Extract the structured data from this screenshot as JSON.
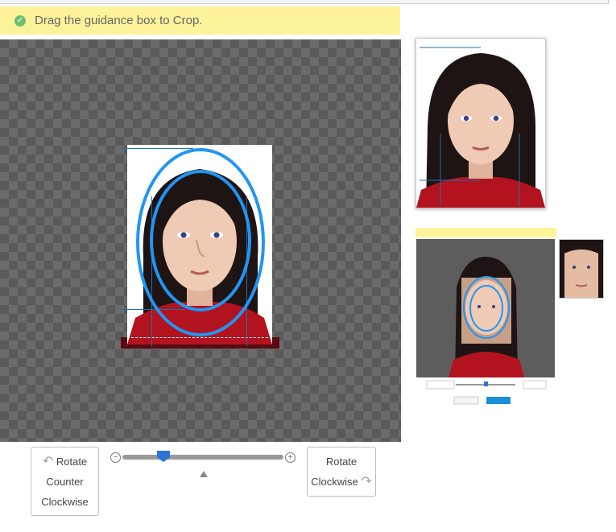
{
  "hint": {
    "text": "Drag the guidance box to Crop.",
    "icon": "check-circle-icon"
  },
  "buttons": {
    "rotate_ccw": [
      "Rotate",
      "Counter",
      "Clockwise"
    ],
    "rotate_cw": [
      "Rotate",
      "Clockwise"
    ]
  },
  "slider": {
    "zoom_fraction": 0.25,
    "minus_icon": "zoom-out-icon",
    "plus_icon": "zoom-in-icon"
  },
  "colors": {
    "hint_bg": "#fdf39b",
    "guide": "#2196f3",
    "shirt": "#b3121f"
  }
}
